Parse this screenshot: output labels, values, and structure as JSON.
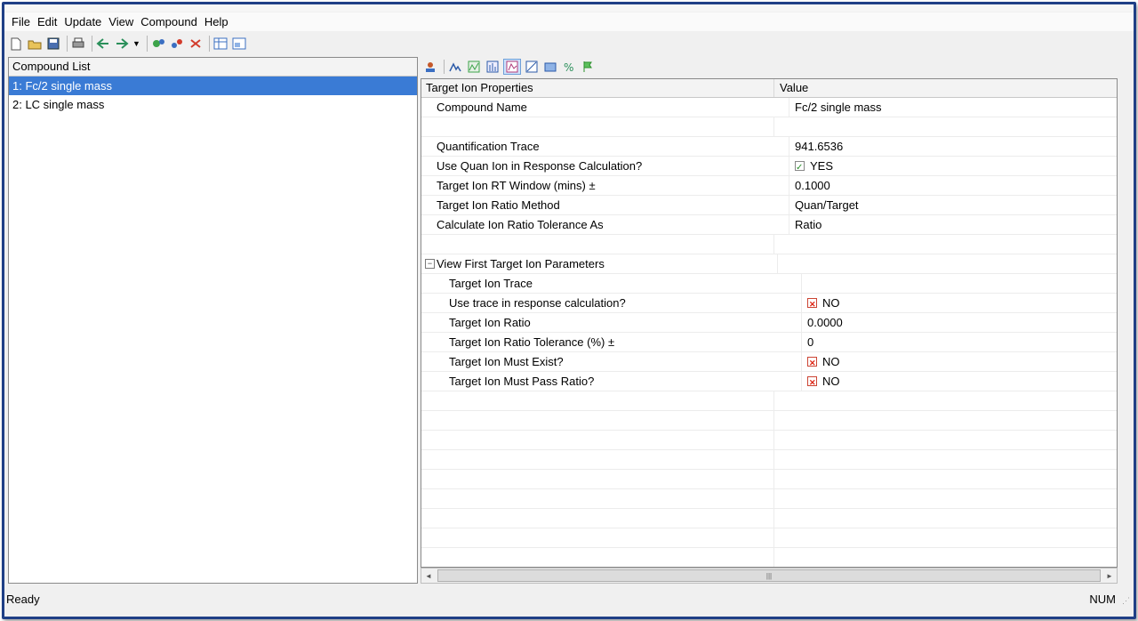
{
  "menu": [
    "File",
    "Edit",
    "Update",
    "View",
    "Compound",
    "Help"
  ],
  "compound_list": {
    "header": "Compound List",
    "items": [
      "1: Fc/2 single mass",
      "2: LC single mass"
    ],
    "selected_index": 0
  },
  "grid": {
    "header_property": "Target Ion Properties",
    "header_value": "Value",
    "compound_name_label": "Compound Name",
    "compound_name_value": "Fc/2 single mass",
    "quant_trace_label": "Quantification Trace",
    "quant_trace_value": "941.6536",
    "use_quan_label": "Use Quan Ion in Response Calculation?",
    "use_quan_value": "YES",
    "rt_window_label": "Target Ion RT Window (mins) ±",
    "rt_window_value": "0.1000",
    "ratio_method_label": "Target Ion Ratio Method",
    "ratio_method_value": "Quan/Target",
    "tolerance_as_label": "Calculate Ion Ratio Tolerance As",
    "tolerance_as_value": "Ratio",
    "section_label": "View First Target Ion Parameters",
    "section_expander": "−",
    "target_trace_label": "Target Ion Trace",
    "target_trace_value": "",
    "use_trace_label": "Use trace in response calculation?",
    "use_trace_value": "NO",
    "target_ratio_label": "Target Ion Ratio",
    "target_ratio_value": "0.0000",
    "ratio_tolerance_label": "Target Ion Ratio Tolerance (%) ±",
    "ratio_tolerance_value": "0",
    "must_exist_label": "Target Ion Must Exist?",
    "must_exist_value": "NO",
    "must_pass_label": "Target Ion Must Pass Ratio?",
    "must_pass_value": "NO"
  },
  "status": {
    "text": "Ready",
    "num": "NUM"
  }
}
